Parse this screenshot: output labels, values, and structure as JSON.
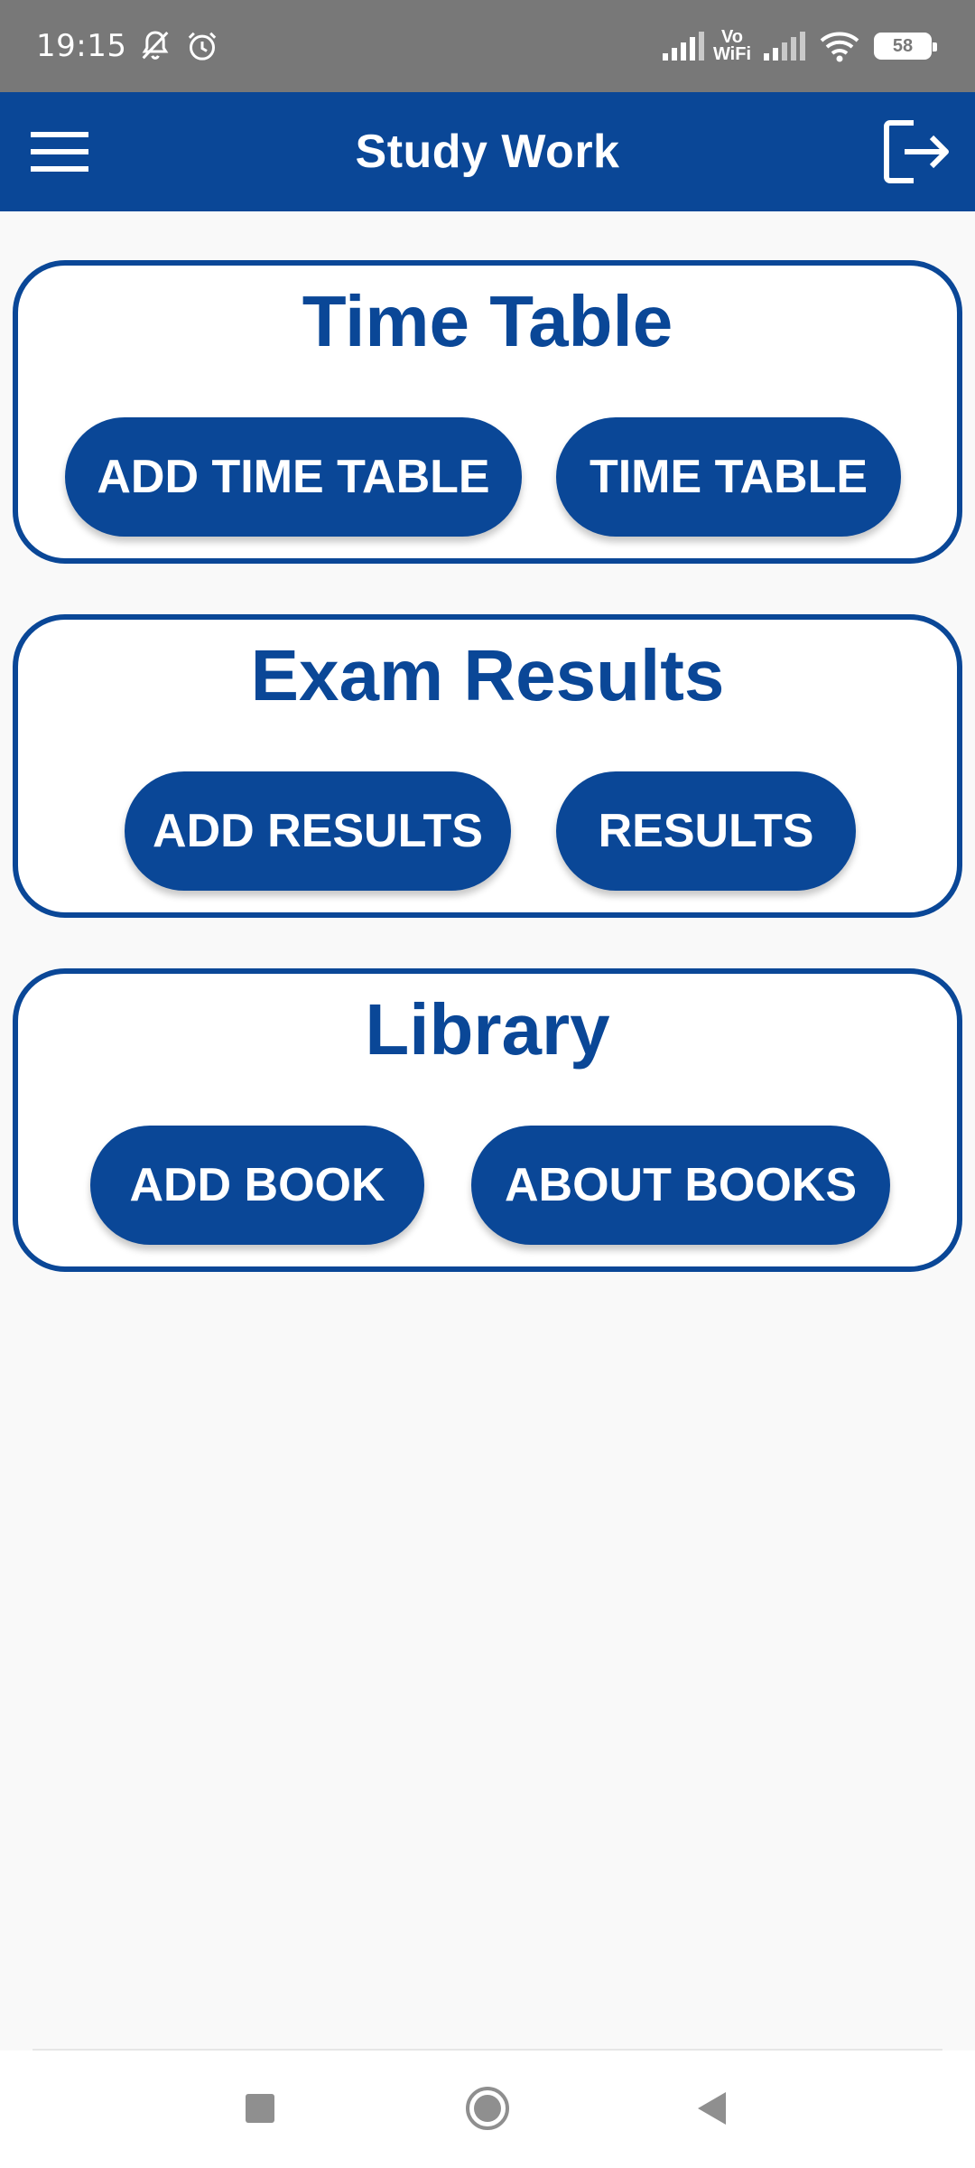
{
  "status_bar": {
    "time": "19:15",
    "vowifi_top": "Vo",
    "vowifi_bottom": "WiFi",
    "battery": "58"
  },
  "app_bar": {
    "title": "Study Work"
  },
  "cards": [
    {
      "title": "Time Table",
      "buttons": [
        "ADD TIME TABLE",
        "TIME TABLE"
      ]
    },
    {
      "title": "Exam Results",
      "buttons": [
        "ADD RESULTS",
        "RESULTS"
      ]
    },
    {
      "title": "Library",
      "buttons": [
        "ADD BOOK",
        "ABOUT BOOKS"
      ]
    }
  ],
  "colors": {
    "primary": "#0a4797",
    "status_bar": "#787878",
    "background": "#f9f9f9"
  },
  "icons": {
    "menu": "hamburger-menu-icon",
    "logout": "logout-icon",
    "nav_recents": "square-icon",
    "nav_home": "circle-icon",
    "nav_back": "back-triangle-icon"
  }
}
